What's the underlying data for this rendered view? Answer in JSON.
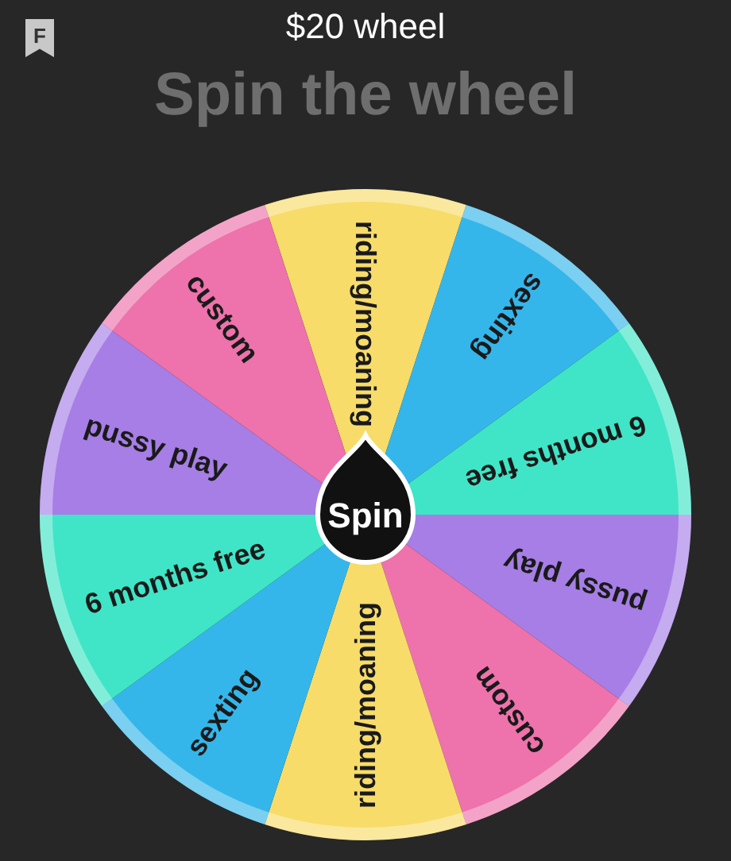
{
  "badge": "F",
  "title": "$20 wheel",
  "heading": "Spin the wheel",
  "segments": [
    {
      "label": "riding/moaning",
      "color": "#f7dc6a"
    },
    {
      "label": "sexting",
      "color": "#35b6ea"
    },
    {
      "label": "6 months free",
      "color": "#3fe5c6"
    },
    {
      "label": "pussy play",
      "color": "#a67ee6"
    },
    {
      "label": "custom",
      "color": "#ee72ab"
    },
    {
      "label": "riding/moaning",
      "color": "#f7dc6a"
    },
    {
      "label": "sexting",
      "color": "#35b6ea"
    },
    {
      "label": "6 months free",
      "color": "#3fe5c6"
    },
    {
      "label": "pussy play",
      "color": "#a67ee6"
    },
    {
      "label": "custom",
      "color": "#ee72ab"
    }
  ],
  "spin_button": "Spin"
}
